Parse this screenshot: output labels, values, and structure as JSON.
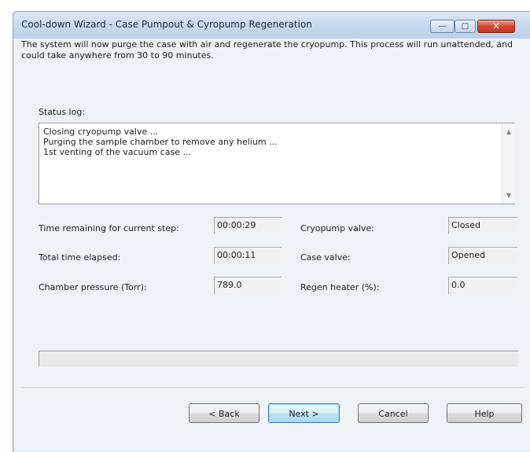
{
  "window": {
    "title": "Cool-down Wizard - Case Pumpout & Cyropump Regeneration",
    "minimize_glyph": "—",
    "maximize_glyph": "□",
    "close_glyph": "✕"
  },
  "intro_text": "The system will now purge the case with air and regenerate the cryopump. This process will run unattended, and could take anywhere from 30 to 90 minutes.",
  "status_log": {
    "label": "Status log:",
    "lines": [
      "Closing cryopump valve ...",
      "Purging the sample chamber to remove any helium ...",
      "1st venting of the vacuum case ..."
    ]
  },
  "fields": {
    "time_remaining": {
      "label": "Time remaining for current step:",
      "value": "00:00:29"
    },
    "total_elapsed": {
      "label": "Total time elapsed:",
      "value": "00:00:11"
    },
    "chamber_pressure": {
      "label": "Chamber pressure (Torr):",
      "value": "789.0"
    },
    "cryopump_valve": {
      "label": "Cryopump valve:",
      "value": "Closed"
    },
    "case_valve": {
      "label": "Case valve:",
      "value": "Opened"
    },
    "regen_heater": {
      "label": "Regen heater (%):",
      "value": "0.0"
    }
  },
  "progress": {
    "fraction": 0.0
  },
  "buttons": {
    "back": "< Back",
    "next": "Next >",
    "cancel": "Cancel",
    "help": "Help"
  },
  "colors": {
    "titlebar": "#c9daef",
    "close_button": "#d24a33",
    "default_button_border": "#3c7fb1"
  }
}
